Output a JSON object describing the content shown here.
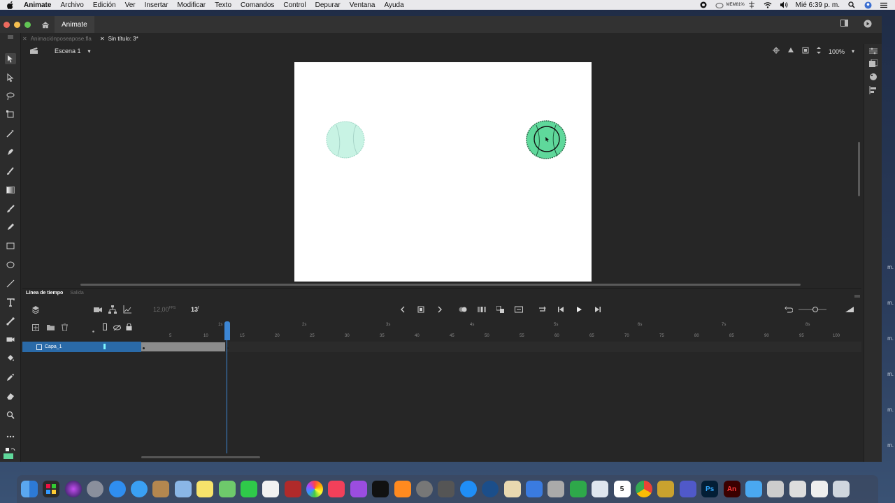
{
  "menubar": {
    "app_name": "Animate",
    "items": [
      "Archivo",
      "Edición",
      "Ver",
      "Insertar",
      "Modificar",
      "Texto",
      "Comandos",
      "Control",
      "Depurar",
      "Ventana",
      "Ayuda"
    ],
    "memory_label": "MEM",
    "memory_value": "81%",
    "clock": "Mié 6:39 p. m."
  },
  "window": {
    "app_tab": "Animate",
    "doc_tabs": [
      "Animaciónposeapose.fla",
      "Sin título: 3*"
    ],
    "scene": "Escena 1",
    "zoom": "100%"
  },
  "timeline": {
    "tabs": [
      "Línea de tiempo",
      "Salida"
    ],
    "fps": "12,00",
    "fps_unit": "FPS",
    "current_frame": "13",
    "frame_unit": "f",
    "layer_name": "Capa_1",
    "ruler_frames": [
      "5",
      "10",
      "15",
      "20",
      "25",
      "30",
      "35",
      "40",
      "45",
      "50",
      "55",
      "60",
      "65",
      "70",
      "75",
      "80",
      "85",
      "90",
      "95",
      "100"
    ],
    "ruler_seconds": [
      "1s",
      "2s",
      "3s",
      "4s",
      "5s",
      "6s",
      "7s",
      "8s"
    ],
    "filled_frames": 12
  },
  "colors": {
    "accent": "#2a6aa8",
    "playhead": "#3c86d4",
    "ball_light": "#c8f3e4",
    "ball_dark": "#5fd89b"
  },
  "dock": {
    "apps": [
      "finder-icon",
      "launchpad-icon",
      "siri-icon",
      "rocket-icon",
      "safari-icon",
      "messages-icon",
      "notes-icon",
      "preview-icon",
      "stickies-icon",
      "maps-icon",
      "facetime-icon",
      "textedit-icon",
      "photo-booth-icon",
      "photos-icon",
      "music-icon",
      "podcasts-icon",
      "appletv-icon",
      "books-icon",
      "system-prefs-icon",
      "screenshot-icon",
      "appstore-icon",
      "quicktime-icon",
      "script-editor-icon",
      "keynote-icon",
      "numbers-icon",
      "pages-icon",
      "finance-icon",
      "calendar-icon",
      "chrome-icon",
      "dictionary-icon",
      "teams-icon"
    ],
    "ps_label": "Ps",
    "an_label": "An",
    "calendar_day": "5"
  },
  "side_labels": [
    "m.",
    "m.",
    "m.",
    "m.",
    "m.",
    "m."
  ]
}
